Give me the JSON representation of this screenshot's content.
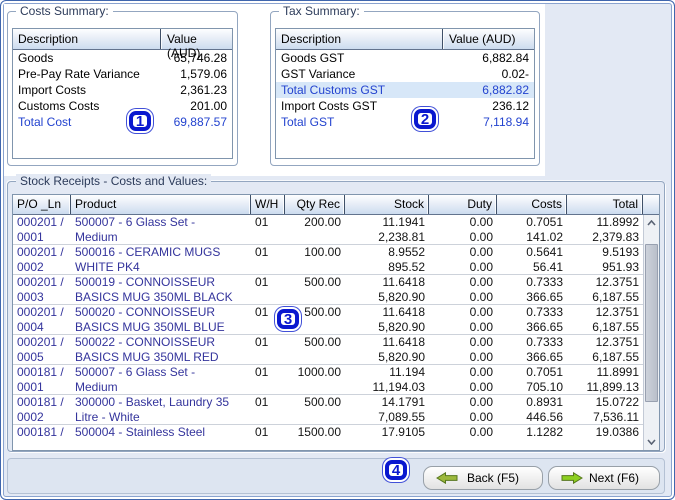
{
  "costs_summary": {
    "title": "Costs Summary:",
    "columns": [
      "Description",
      "Value (AUD)"
    ],
    "rows": [
      {
        "label": "Goods",
        "value": "65,746.28",
        "emphasis": false,
        "highlight": false
      },
      {
        "label": "Pre-Pay Rate Variance",
        "value": "1,579.06",
        "emphasis": false,
        "highlight": false
      },
      {
        "label": "Import Costs",
        "value": "2,361.23",
        "emphasis": false,
        "highlight": false
      },
      {
        "label": "Customs Costs",
        "value": "201.00",
        "emphasis": false,
        "highlight": false
      },
      {
        "label": "Total Cost",
        "value": "69,887.57",
        "emphasis": true,
        "highlight": false
      }
    ]
  },
  "tax_summary": {
    "title": "Tax Summary:",
    "columns": [
      "Description",
      "Value (AUD)"
    ],
    "rows": [
      {
        "label": "Goods GST",
        "value": "6,882.84",
        "emphasis": false,
        "highlight": false
      },
      {
        "label": "GST Variance",
        "value": "0.02-",
        "emphasis": false,
        "highlight": false
      },
      {
        "label": "Total Customs GST",
        "value": "6,882.82",
        "emphasis": true,
        "highlight": true
      },
      {
        "label": "",
        "value": "",
        "emphasis": false,
        "highlight": false
      },
      {
        "label": "Import Costs GST",
        "value": "236.12",
        "emphasis": false,
        "highlight": false
      },
      {
        "label": "Total GST",
        "value": "7,118.94",
        "emphasis": true,
        "highlight": false
      }
    ]
  },
  "stock_receipts": {
    "title": "Stock Receipts - Costs and Values:",
    "columns": [
      "P/O _Ln",
      "Product",
      "W/H",
      "Qty Rec",
      "Stock",
      "Duty",
      "Costs",
      "Total"
    ],
    "rows": [
      {
        "po": [
          "000201 /",
          "0001"
        ],
        "product": [
          "500007 - 6 Glass Set -",
          "Medium"
        ],
        "wh": "01",
        "qty": "200.00",
        "stock": [
          "11.1941",
          "2,238.81"
        ],
        "duty": [
          "0.00",
          "0.00"
        ],
        "costs": [
          "0.7051",
          "141.02"
        ],
        "total": [
          "11.8992",
          "2,379.83"
        ]
      },
      {
        "po": [
          "000201 /",
          "0002"
        ],
        "product": [
          "500016 - CERAMIC MUGS",
          "WHITE PK4"
        ],
        "wh": "01",
        "qty": "100.00",
        "stock": [
          "8.9552",
          "895.52"
        ],
        "duty": [
          "0.00",
          "0.00"
        ],
        "costs": [
          "0.5641",
          "56.41"
        ],
        "total": [
          "9.5193",
          "951.93"
        ]
      },
      {
        "po": [
          "000201 /",
          "0003"
        ],
        "product": [
          "500019 - CONNOISSEUR",
          "BASICS MUG 350ML BLACK"
        ],
        "wh": "01",
        "qty": "500.00",
        "stock": [
          "11.6418",
          "5,820.90"
        ],
        "duty": [
          "0.00",
          "0.00"
        ],
        "costs": [
          "0.7333",
          "366.65"
        ],
        "total": [
          "12.3751",
          "6,187.55"
        ]
      },
      {
        "po": [
          "000201 /",
          "0004"
        ],
        "product": [
          "500020 - CONNOISSEUR",
          "BASICS MUG 350ML BLUE"
        ],
        "wh": "01",
        "qty": "500.00",
        "stock": [
          "11.6418",
          "5,820.90"
        ],
        "duty": [
          "0.00",
          "0.00"
        ],
        "costs": [
          "0.7333",
          "366.65"
        ],
        "total": [
          "12.3751",
          "6,187.55"
        ]
      },
      {
        "po": [
          "000201 /",
          "0005"
        ],
        "product": [
          "500022 - CONNOISSEUR",
          "BASICS MUG 350ML RED"
        ],
        "wh": "01",
        "qty": "500.00",
        "stock": [
          "11.6418",
          "5,820.90"
        ],
        "duty": [
          "0.00",
          "0.00"
        ],
        "costs": [
          "0.7333",
          "366.65"
        ],
        "total": [
          "12.3751",
          "6,187.55"
        ]
      },
      {
        "po": [
          "000181 /",
          "0001"
        ],
        "product": [
          "500007 - 6 Glass Set -",
          "Medium"
        ],
        "wh": "01",
        "qty": "1000.00",
        "stock": [
          "11.194",
          "11,194.03"
        ],
        "duty": [
          "0.00",
          "0.00"
        ],
        "costs": [
          "0.7051",
          "705.10"
        ],
        "total": [
          "11.8991",
          "11,899.13"
        ]
      },
      {
        "po": [
          "000181 /",
          "0002"
        ],
        "product": [
          "300000 - Basket, Laundry 35",
          "Litre - White"
        ],
        "wh": "01",
        "qty": "500.00",
        "stock": [
          "14.1791",
          "7,089.55"
        ],
        "duty": [
          "0.00",
          "0.00"
        ],
        "costs": [
          "0.8931",
          "446.56"
        ],
        "total": [
          "15.0722",
          "7,536.11"
        ]
      },
      {
        "po": [
          "000181 /",
          ""
        ],
        "product": [
          "500004 - Stainless Steel",
          ""
        ],
        "wh": "01",
        "qty": "1500.00",
        "stock": [
          "17.9105",
          ""
        ],
        "duty": [
          "0.00",
          ""
        ],
        "costs": [
          "1.1282",
          ""
        ],
        "total": [
          "19.0386",
          ""
        ]
      }
    ]
  },
  "footer": {
    "back_label": "Back (F5)",
    "next_label": "Next (F6)"
  },
  "badges": [
    "1",
    "2",
    "3",
    "4"
  ],
  "colors": {
    "total_blue": "#2343cf",
    "record_blue": "#34349c",
    "badge_blue": "#0a18cf",
    "highlight_row": "#d7e7f8",
    "arrow_green_back": "#9cb83c",
    "arrow_green_next": "#8ccf1f",
    "arrow_outline": "#55761c"
  }
}
